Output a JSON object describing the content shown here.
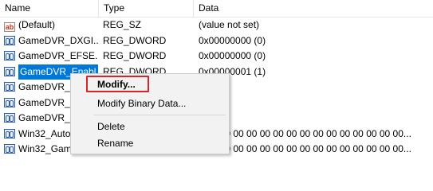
{
  "header": {
    "name": "Name",
    "type": "Type",
    "data": "Data"
  },
  "rows": [
    {
      "name": "(Default)",
      "type": "REG_SZ",
      "data": "(value not set)",
      "icon": "string-value-icon"
    },
    {
      "name": "GameDVR_DXGI...",
      "type": "REG_DWORD",
      "data": "0x00000000 (0)",
      "icon": "binary-value-icon"
    },
    {
      "name": "GameDVR_EFSE...",
      "type": "REG_DWORD",
      "data": "0x00000000 (0)",
      "icon": "binary-value-icon"
    },
    {
      "name": "GameDVR_Enabl...",
      "type": "REG_DWORD",
      "data": "0x00000001 (1)",
      "icon": "binary-value-icon",
      "selected": true
    },
    {
      "name": "GameDVR_F",
      "type": "",
      "data": "",
      "icon": "binary-value-icon"
    },
    {
      "name": "GameDVR_F",
      "type": "",
      "data": "",
      "icon": "binary-value-icon"
    },
    {
      "name": "GameDVR_H",
      "type": "",
      "data": "",
      "icon": "binary-value-icon"
    },
    {
      "name": "Win32_Auto",
      "type": "",
      "data": "1 00 00 00 00 00 00 00 00 00 00 00 00 00 00 00...",
      "icon": "binary-value-icon"
    },
    {
      "name": "Win32_Gam",
      "type": "",
      "data": "0 00 00 00 00 00 00 00 00 00 00 00 00 00 00 00...",
      "icon": "binary-value-icon"
    }
  ],
  "context_menu": {
    "modify": "Modify...",
    "modify_binary": "Modify Binary Data...",
    "delete": "Delete",
    "rename": "Rename"
  },
  "colors": {
    "selection": "#0078d7",
    "highlight_border": "#d9232b",
    "menu_background": "#f2f2f2"
  }
}
